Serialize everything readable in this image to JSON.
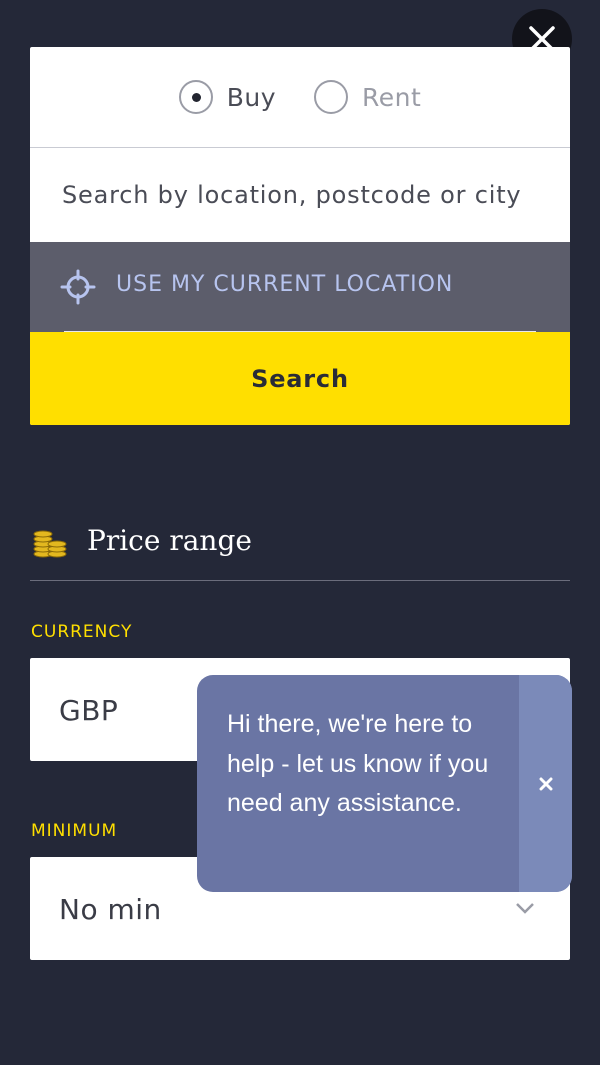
{
  "search": {
    "tenure": [
      {
        "label": "Buy",
        "checked": true
      },
      {
        "label": "Rent",
        "checked": false
      }
    ],
    "placeholder": "Search by location, postcode or city",
    "location_label": "USE MY CURRENT LOCATION",
    "search_label": "Search"
  },
  "price": {
    "title": "Price range",
    "currency_label": "CURRENCY",
    "currency_value": "GBP",
    "minimum_label": "MINIMUM",
    "minimum_value": "No min"
  },
  "chat": {
    "message": "Hi there, we're here to help - let us know if you need any assistance."
  },
  "icons": {
    "close": "close-icon",
    "location": "crosshair-icon",
    "coins": "coins-icon",
    "chevron": "chevron-down-icon",
    "chat_close": "close-icon"
  },
  "colors": {
    "background": "#242838",
    "accent": "#ffdf00",
    "location_bar": "#5c5d6b",
    "chat_bubble": "#6a75a4"
  }
}
